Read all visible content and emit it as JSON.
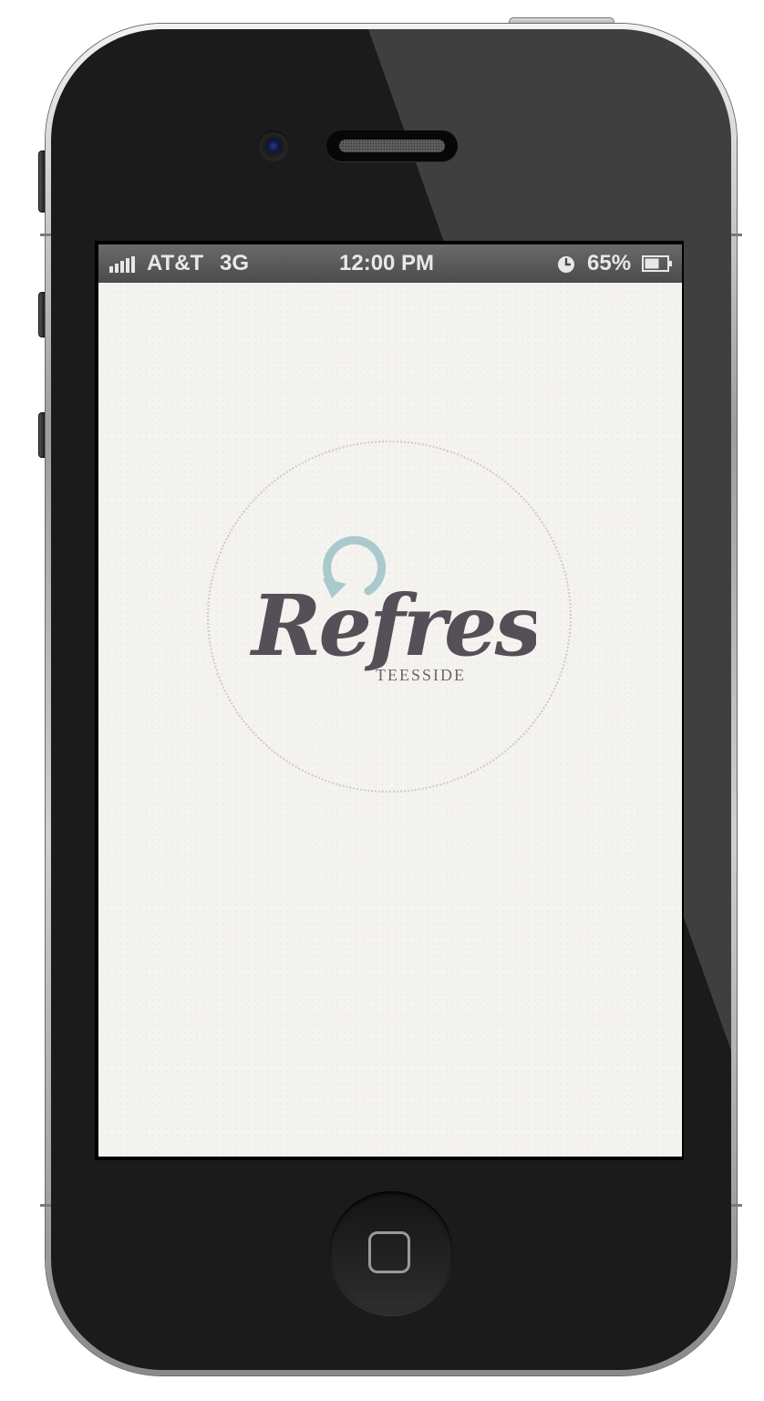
{
  "status_bar": {
    "carrier": "AT&T",
    "network": "3G",
    "time": "12:00 PM",
    "battery_percent": "65%",
    "battery_level": 0.65,
    "signal_bars": 5
  },
  "splash": {
    "logo_word": "Refresh",
    "logo_subtitle": "TEESSIDE",
    "refresh_icon_color": "#a9c9cc",
    "logo_text_color": "#574f58",
    "background_color": "#f4f3ef"
  },
  "device": {
    "body_color": "#1b1b1b"
  }
}
